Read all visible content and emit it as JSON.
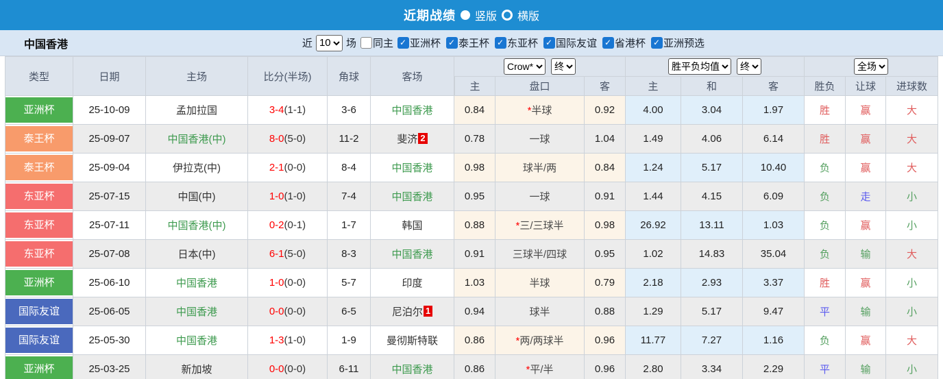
{
  "title_bar": {
    "title": "近期战绩",
    "options": [
      {
        "label": "竖版",
        "selected": true
      },
      {
        "label": "横版",
        "selected": false
      }
    ]
  },
  "filter_bar": {
    "team": "中国香港",
    "recent_label": "近",
    "recent_value": "10",
    "unit_label": "场",
    "same_home_label": "同主",
    "same_home_checked": false,
    "competitions": [
      "亚洲杯",
      "泰王杯",
      "东亚杯",
      "国际友谊",
      "省港杯",
      "亚洲预选"
    ]
  },
  "table": {
    "static_headers": [
      "类型",
      "日期",
      "主场",
      "比分(半场)",
      "角球",
      "客场"
    ],
    "group_handicap": {
      "market_select": "Crow*",
      "time_select": "终",
      "cols": [
        "主",
        "盘口",
        "客"
      ]
    },
    "group_avg": {
      "market_select": "胜平负均值",
      "time_select": "终",
      "cols": [
        "主",
        "和",
        "客"
      ]
    },
    "group_result": {
      "scope_select": "全场",
      "cols": [
        "胜负",
        "让球",
        "进球数"
      ]
    },
    "rows": [
      {
        "type": "亚洲杯",
        "type_color": "green",
        "date": "25-10-09",
        "home": "孟加拉国",
        "home_color": "",
        "score_ft": "3-4",
        "score_ht": "(1-1)",
        "corner": "3-6",
        "away": "中国香港",
        "away_color": "green",
        "away_badge": "",
        "odds_home": "0.84",
        "handicap_star": "*",
        "handicap": "半球",
        "odds_away": "0.92",
        "avg_home": "4.00",
        "avg_draw": "3.04",
        "avg_away": "1.97",
        "result": "胜",
        "result_color": "red",
        "handicap_result": "赢",
        "handicap_result_color": "red",
        "goals": "大",
        "goals_color": "red"
      },
      {
        "type": "泰王杯",
        "type_color": "orange",
        "date": "25-09-07",
        "home": "中国香港(中)",
        "home_color": "green",
        "score_ft": "8-0",
        "score_ht": "(5-0)",
        "corner": "11-2",
        "away": "斐济",
        "away_color": "",
        "away_badge": "2",
        "odds_home": "0.78",
        "handicap_star": "",
        "handicap": "一球",
        "odds_away": "1.04",
        "avg_home": "1.49",
        "avg_draw": "4.06",
        "avg_away": "6.14",
        "result": "胜",
        "result_color": "red",
        "handicap_result": "赢",
        "handicap_result_color": "red",
        "goals": "大",
        "goals_color": "red"
      },
      {
        "type": "泰王杯",
        "type_color": "orange",
        "date": "25-09-04",
        "home": "伊拉克(中)",
        "home_color": "",
        "score_ft": "2-1",
        "score_ht": "(0-0)",
        "corner": "8-4",
        "away": "中国香港",
        "away_color": "green",
        "away_badge": "",
        "odds_home": "0.98",
        "handicap_star": "",
        "handicap": "球半/两",
        "odds_away": "0.84",
        "avg_home": "1.24",
        "avg_draw": "5.17",
        "avg_away": "10.40",
        "result": "负",
        "result_color": "green",
        "handicap_result": "赢",
        "handicap_result_color": "red",
        "goals": "大",
        "goals_color": "red"
      },
      {
        "type": "东亚杯",
        "type_color": "red",
        "date": "25-07-15",
        "home": "中国(中)",
        "home_color": "",
        "score_ft": "1-0",
        "score_ht": "(1-0)",
        "corner": "7-4",
        "away": "中国香港",
        "away_color": "green",
        "away_badge": "",
        "odds_home": "0.95",
        "handicap_star": "",
        "handicap": "一球",
        "odds_away": "0.91",
        "avg_home": "1.44",
        "avg_draw": "4.15",
        "avg_away": "6.09",
        "result": "负",
        "result_color": "green",
        "handicap_result": "走",
        "handicap_result_color": "blue",
        "goals": "小",
        "goals_color": "green"
      },
      {
        "type": "东亚杯",
        "type_color": "red",
        "date": "25-07-11",
        "home": "中国香港(中)",
        "home_color": "green",
        "score_ft": "0-2",
        "score_ht": "(0-1)",
        "corner": "1-7",
        "away": "韩国",
        "away_color": "",
        "away_badge": "",
        "odds_home": "0.88",
        "handicap_star": "*",
        "handicap": "三/三球半",
        "odds_away": "0.98",
        "avg_home": "26.92",
        "avg_draw": "13.11",
        "avg_away": "1.03",
        "result": "负",
        "result_color": "green",
        "handicap_result": "赢",
        "handicap_result_color": "red",
        "goals": "小",
        "goals_color": "green"
      },
      {
        "type": "东亚杯",
        "type_color": "red",
        "date": "25-07-08",
        "home": "日本(中)",
        "home_color": "",
        "score_ft": "6-1",
        "score_ht": "(5-0)",
        "corner": "8-3",
        "away": "中国香港",
        "away_color": "green",
        "away_badge": "",
        "odds_home": "0.91",
        "handicap_star": "",
        "handicap": "三球半/四球",
        "odds_away": "0.95",
        "avg_home": "1.02",
        "avg_draw": "14.83",
        "avg_away": "35.04",
        "result": "负",
        "result_color": "green",
        "handicap_result": "输",
        "handicap_result_color": "green",
        "goals": "大",
        "goals_color": "red"
      },
      {
        "type": "亚洲杯",
        "type_color": "green",
        "date": "25-06-10",
        "home": "中国香港",
        "home_color": "green",
        "score_ft": "1-0",
        "score_ht": "(0-0)",
        "corner": "5-7",
        "away": "印度",
        "away_color": "",
        "away_badge": "",
        "odds_home": "1.03",
        "handicap_star": "",
        "handicap": "半球",
        "odds_away": "0.79",
        "avg_home": "2.18",
        "avg_draw": "2.93",
        "avg_away": "3.37",
        "result": "胜",
        "result_color": "red",
        "handicap_result": "赢",
        "handicap_result_color": "red",
        "goals": "小",
        "goals_color": "green"
      },
      {
        "type": "国际友谊",
        "type_color": "blue",
        "date": "25-06-05",
        "home": "中国香港",
        "home_color": "green",
        "score_ft": "0-0",
        "score_ht": "(0-0)",
        "corner": "6-5",
        "away": "尼泊尔",
        "away_color": "",
        "away_badge": "1",
        "odds_home": "0.94",
        "handicap_star": "",
        "handicap": "球半",
        "odds_away": "0.88",
        "avg_home": "1.29",
        "avg_draw": "5.17",
        "avg_away": "9.47",
        "result": "平",
        "result_color": "blue",
        "handicap_result": "输",
        "handicap_result_color": "green",
        "goals": "小",
        "goals_color": "green"
      },
      {
        "type": "国际友谊",
        "type_color": "blue",
        "date": "25-05-30",
        "home": "中国香港",
        "home_color": "green",
        "score_ft": "1-3",
        "score_ht": "(1-0)",
        "corner": "1-9",
        "away": "曼彻斯特联",
        "away_color": "",
        "away_badge": "",
        "odds_home": "0.86",
        "handicap_star": "*",
        "handicap": "两/两球半",
        "odds_away": "0.96",
        "avg_home": "11.77",
        "avg_draw": "7.27",
        "avg_away": "1.16",
        "result": "负",
        "result_color": "green",
        "handicap_result": "赢",
        "handicap_result_color": "red",
        "goals": "大",
        "goals_color": "red"
      },
      {
        "type": "亚洲杯",
        "type_color": "green",
        "date": "25-03-25",
        "home": "新加坡",
        "home_color": "",
        "score_ft": "0-0",
        "score_ht": "(0-0)",
        "corner": "6-11",
        "away": "中国香港",
        "away_color": "green",
        "away_badge": "",
        "odds_home": "0.86",
        "handicap_star": "*",
        "handicap": "平/半",
        "odds_away": "0.96",
        "avg_home": "2.80",
        "avg_draw": "3.34",
        "avg_away": "2.29",
        "result": "平",
        "result_color": "blue",
        "handicap_result": "输",
        "handicap_result_color": "green",
        "goals": "小",
        "goals_color": "green"
      }
    ]
  },
  "colors": {
    "accent_blue": "#1e8dd2",
    "asian_cup_green": "#4cb050",
    "kings_cup_orange": "#f89b6b",
    "east_asian_red": "#f56e6e",
    "friendly_blue": "#4a69bd",
    "team_green": "#3d9a4e",
    "score_red": "#ff0000",
    "win_red": "#e05c5c",
    "lose_green": "#55a060",
    "draw_blue": "#5b5bef"
  }
}
